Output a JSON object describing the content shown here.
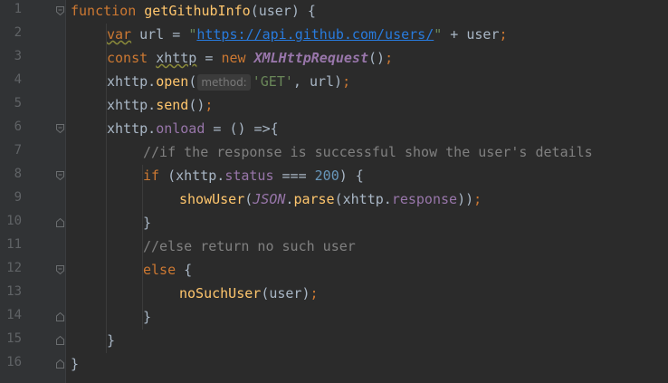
{
  "editor": {
    "lines": [
      {
        "n": "1",
        "fold": "open"
      },
      {
        "n": "2"
      },
      {
        "n": "3"
      },
      {
        "n": "4"
      },
      {
        "n": "5"
      },
      {
        "n": "6",
        "fold": "open"
      },
      {
        "n": "7"
      },
      {
        "n": "8",
        "fold": "open"
      },
      {
        "n": "9"
      },
      {
        "n": "10",
        "fold": "close"
      },
      {
        "n": "11"
      },
      {
        "n": "12",
        "fold": "open"
      },
      {
        "n": "13"
      },
      {
        "n": "14",
        "fold": "close"
      },
      {
        "n": "15",
        "fold": "close"
      },
      {
        "n": "16",
        "fold": "close"
      }
    ],
    "tokens": {
      "l1_kw": "function",
      "l1_fn": "getGithubInfo",
      "l1_rest": "(user) {",
      "l2_kw": "var",
      "l2_a": " url = ",
      "l2_q1": "\"",
      "l2_url": "https://api.github.com/users/",
      "l2_q2": "\"",
      "l2_b": " + user",
      "l2_semi": ";",
      "l3_kw": "const",
      "l3_var": "xhttp",
      "l3_a": " = ",
      "l3_new": "new",
      "l3_cls": "XMLHttpRequest",
      "l3_b": "()",
      "l3_semi": ";",
      "l4_a": "xhttp.",
      "l4_fn": "open",
      "l4_b": "(",
      "l4_hint": "method:",
      "l4_str": "'GET'",
      "l4_c": ", url)",
      "l4_semi": ";",
      "l5_a": "xhttp.",
      "l5_fn": "send",
      "l5_b": "()",
      "l5_semi": ";",
      "l6_a": "xhttp.",
      "l6_prop": "onload",
      "l6_b": " = () =>{",
      "l7_cmt": "//if the response is successful show the user's details",
      "l8_kw": "if",
      "l8_a": " (xhttp.",
      "l8_prop": "status",
      "l8_b": " === ",
      "l8_num": "200",
      "l8_c": ") {",
      "l9_fn": "showUser",
      "l9_a": "(",
      "l9_json": "JSON",
      "l9_b": ".",
      "l9_fn2": "parse",
      "l9_c": "(xhttp.",
      "l9_prop": "response",
      "l9_d": "))",
      "l9_semi": ";",
      "l10": "}",
      "l11_cmt": "//else return no such user",
      "l12_kw": "else",
      "l12_a": " {",
      "l13_fn": "noSuchUser",
      "l13_a": "(user)",
      "l13_semi": ";",
      "l14": "}",
      "l15": "}",
      "l16": "}"
    }
  }
}
